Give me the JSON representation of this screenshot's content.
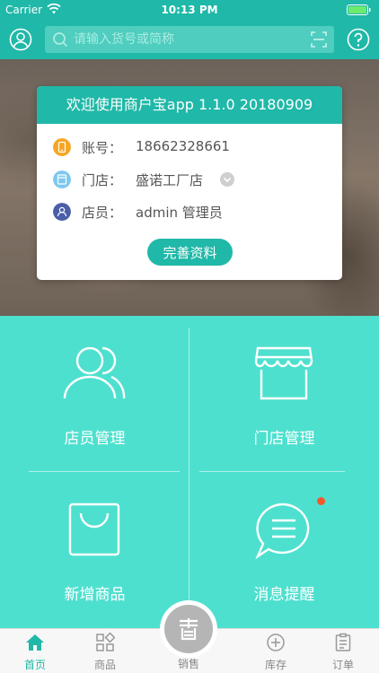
{
  "status_bar": {
    "carrier": "Carrier",
    "time": "10:13 PM"
  },
  "header": {
    "search_placeholder": "请输入货号或简称"
  },
  "card": {
    "title": "欢迎使用商户宝app 1.1.0 20180909",
    "account_label": "账号：",
    "account_value": "18662328661",
    "store_label": "门店：",
    "store_value": "盛诺工厂店",
    "staff_label": "店员：",
    "staff_value": "admin 管理员",
    "complete_button": "完善资料"
  },
  "grid": {
    "staff_management": "店员管理",
    "store_management": "门店管理",
    "add_product": "新增商品",
    "message_reminder": "消息提醒"
  },
  "tabs": {
    "home": "首页",
    "products": "商品",
    "sales": "销售",
    "inventory": "库存",
    "orders": "订单"
  },
  "colors": {
    "primary": "#20b8a8",
    "tile_bg": "#4ee0cf",
    "notification_dot": "#f05a2a",
    "account_icon": "#f5a623",
    "store_icon": "#7ec8f0",
    "staff_icon": "#4a5fa8"
  }
}
